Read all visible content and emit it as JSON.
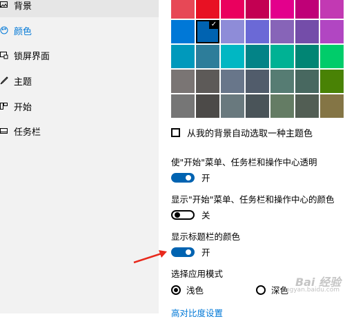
{
  "sidebar": {
    "items": [
      {
        "label": "背景",
        "icon": "picture-icon"
      },
      {
        "label": "颜色",
        "icon": "palette-icon"
      },
      {
        "label": "锁屏界面",
        "icon": "lock-screen-icon"
      },
      {
        "label": "主题",
        "icon": "brush-icon"
      },
      {
        "label": "开始",
        "icon": "start-icon"
      },
      {
        "label": "任务栏",
        "icon": "taskbar-icon"
      }
    ]
  },
  "colors": {
    "rows": [
      [
        "#e74856",
        "#e81123",
        "#ea005e",
        "#c30052",
        "#e3008c",
        "#bf0077",
        "#c239b3"
      ],
      [
        "#0078d7",
        "#0063b1",
        "#8e8cd8",
        "#6b69d6",
        "#8764b8",
        "#744da9",
        "#b146c2"
      ],
      [
        "#0099bc",
        "#2d7d9a",
        "#00b7c3",
        "#038387",
        "#00b294",
        "#018574",
        "#00cc6a"
      ],
      [
        "#7a7574",
        "#5d5a58",
        "#68768a",
        "#515c6b",
        "#567c73",
        "#486860",
        "#498205"
      ],
      [
        "#767676",
        "#4c4a48",
        "#69797e",
        "#4a5459",
        "#647c64",
        "#525e54",
        "#847545"
      ]
    ],
    "selected_row": 1,
    "selected_col": 1,
    "check_glyph": "✓"
  },
  "settings": {
    "auto_pick_label": "从我的背景自动选取一种主题色",
    "transparency_label": "使\"开始\"菜单、任务栏和操作中心透明",
    "transparency_state": "开",
    "show_start_color_label": "显示\"开始\"菜单、任务栏和操作中心的颜色",
    "show_start_color_state": "关",
    "title_bar_label": "显示标题栏的颜色",
    "title_bar_state": "开",
    "app_mode_label": "选择应用模式",
    "light_label": "浅色",
    "dark_label": "深色",
    "high_contrast_link": "高对比度设置"
  },
  "watermark": {
    "text": "Bai 经验",
    "sub": "jingyan.baidu.com"
  },
  "accent_color": "#0078d7",
  "arrow_color": "#e8291c"
}
